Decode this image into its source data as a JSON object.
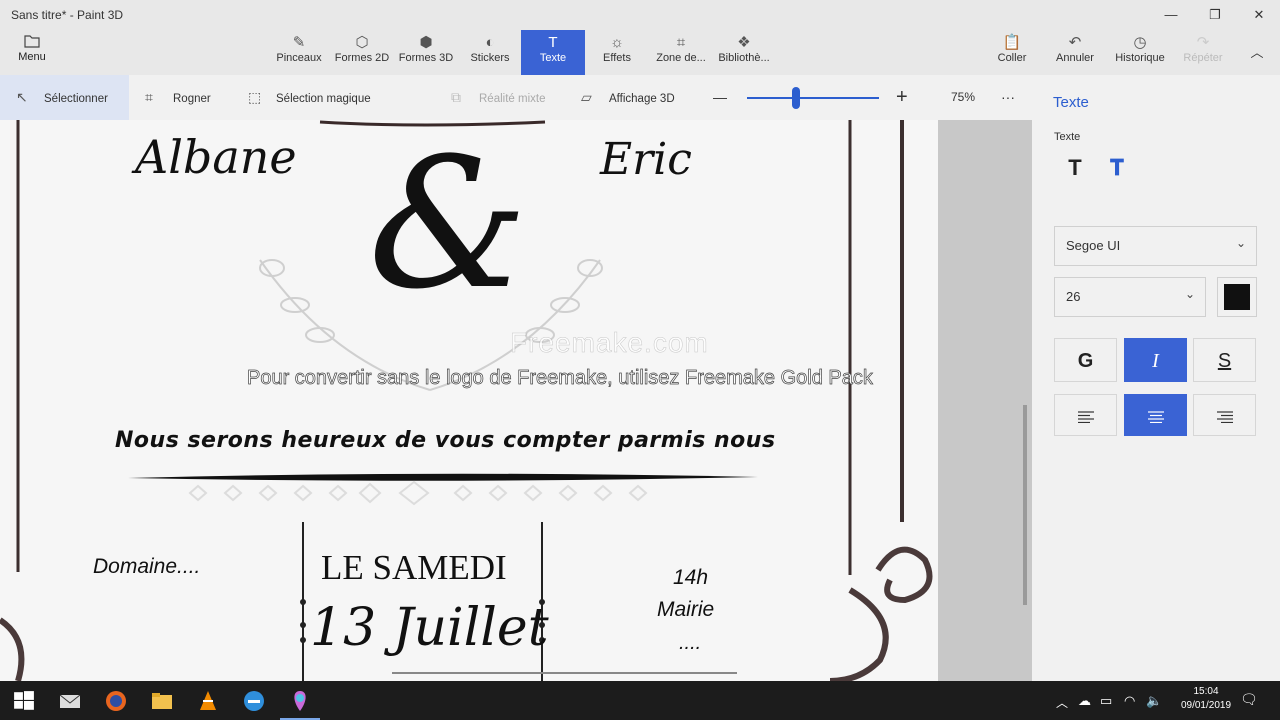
{
  "window": {
    "title": "Sans titre* - Paint 3D"
  },
  "ribbon": {
    "menu_label": "Menu",
    "tools": [
      {
        "label": "Pinceaux"
      },
      {
        "label": "Formes 2D"
      },
      {
        "label": "Formes 3D"
      },
      {
        "label": "Stickers"
      },
      {
        "label": "Texte"
      },
      {
        "label": "Effets"
      },
      {
        "label": "Zone de..."
      },
      {
        "label": "Bibliothè..."
      }
    ],
    "right": {
      "paste": "Coller",
      "undo": "Annuler",
      "history": "Historique",
      "redo": "Répéter"
    }
  },
  "toolbar": {
    "select": "Sélectionner",
    "crop": "Rogner",
    "magic_select": "Sélection magique",
    "mixed_reality": "Réalité mixte",
    "view3d": "Affichage 3D",
    "zoom_minus": "—",
    "zoom_plus": "+",
    "zoom": "75%",
    "more": "···"
  },
  "canvas": {
    "name_left": "Albane",
    "ampersand": "&",
    "name_right": "Eric",
    "tagline": "Nous serons heureux de vous compter parmis nous",
    "venue": "Domaine....",
    "day": "LE SAMEDI",
    "date": "13 Juillet",
    "time": "14h",
    "place": "Mairie",
    "dots": "....",
    "watermark_logo": "Freemake.com",
    "watermark_text": "Pour convertir sans le logo de Freemake, utilisez Freemake Gold Pack"
  },
  "panel": {
    "title": "Texte",
    "label": "Texte",
    "font": "Segoe UI",
    "size": "26",
    "bold": "G",
    "italic": "I",
    "strike": "S",
    "color": "#111111"
  },
  "taskbar": {
    "time": "15:04",
    "date": "09/01/2019"
  },
  "colors": {
    "accent": "#3a63d4"
  }
}
